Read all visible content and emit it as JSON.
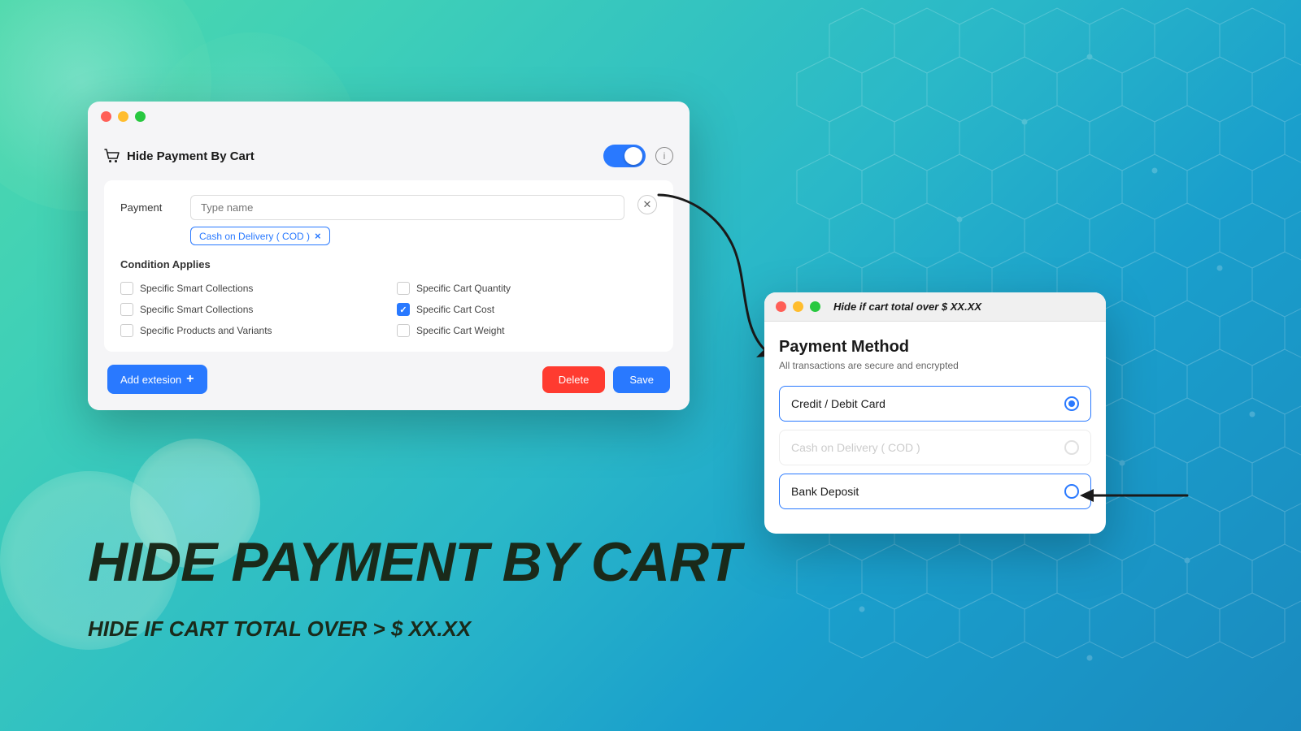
{
  "background": {
    "gradient_start": "#4dd9ac",
    "gradient_end": "#1a8abf"
  },
  "main_window": {
    "title": "Hide Payment By Cart",
    "traffic_lights": [
      "red",
      "yellow",
      "green"
    ],
    "toggle_on": true,
    "payment_label": "Payment",
    "payment_input_placeholder": "Type name",
    "cod_tag": "Cash on Delivery ( COD )",
    "cod_tag_x": "×",
    "condition_title": "Condition Applies",
    "checkboxes": [
      {
        "label": "Specific Smart Collections",
        "checked": false,
        "column": "left"
      },
      {
        "label": "Specific Cart Quantity",
        "checked": false,
        "column": "right"
      },
      {
        "label": "Specific Smart Collections",
        "checked": false,
        "column": "left"
      },
      {
        "label": "Specific Cart Cost",
        "checked": true,
        "column": "right"
      },
      {
        "label": "Specific Products and Variants",
        "checked": false,
        "column": "left"
      },
      {
        "label": "Specific Cart Weight",
        "checked": false,
        "column": "right"
      }
    ],
    "add_extension_label": "Add extesion",
    "delete_label": "Delete",
    "save_label": "Save"
  },
  "big_text": {
    "title": "HIDE PAYMENT BY CART",
    "subtitle": "HIDE IF CART TOTAL OVER > $ XX.XX"
  },
  "payment_window": {
    "note": "Hide if cart total over $ XX.XX",
    "title": "Payment Method",
    "subtitle": "All transactions are secure and encrypted",
    "options": [
      {
        "label": "Credit / Debit Card",
        "selected": true,
        "disabled": false
      },
      {
        "label": "Cash on Delivery ( COD )",
        "selected": false,
        "disabled": true
      },
      {
        "label": "Bank Deposit",
        "selected": false,
        "disabled": false
      }
    ]
  },
  "info_icon_label": "i"
}
